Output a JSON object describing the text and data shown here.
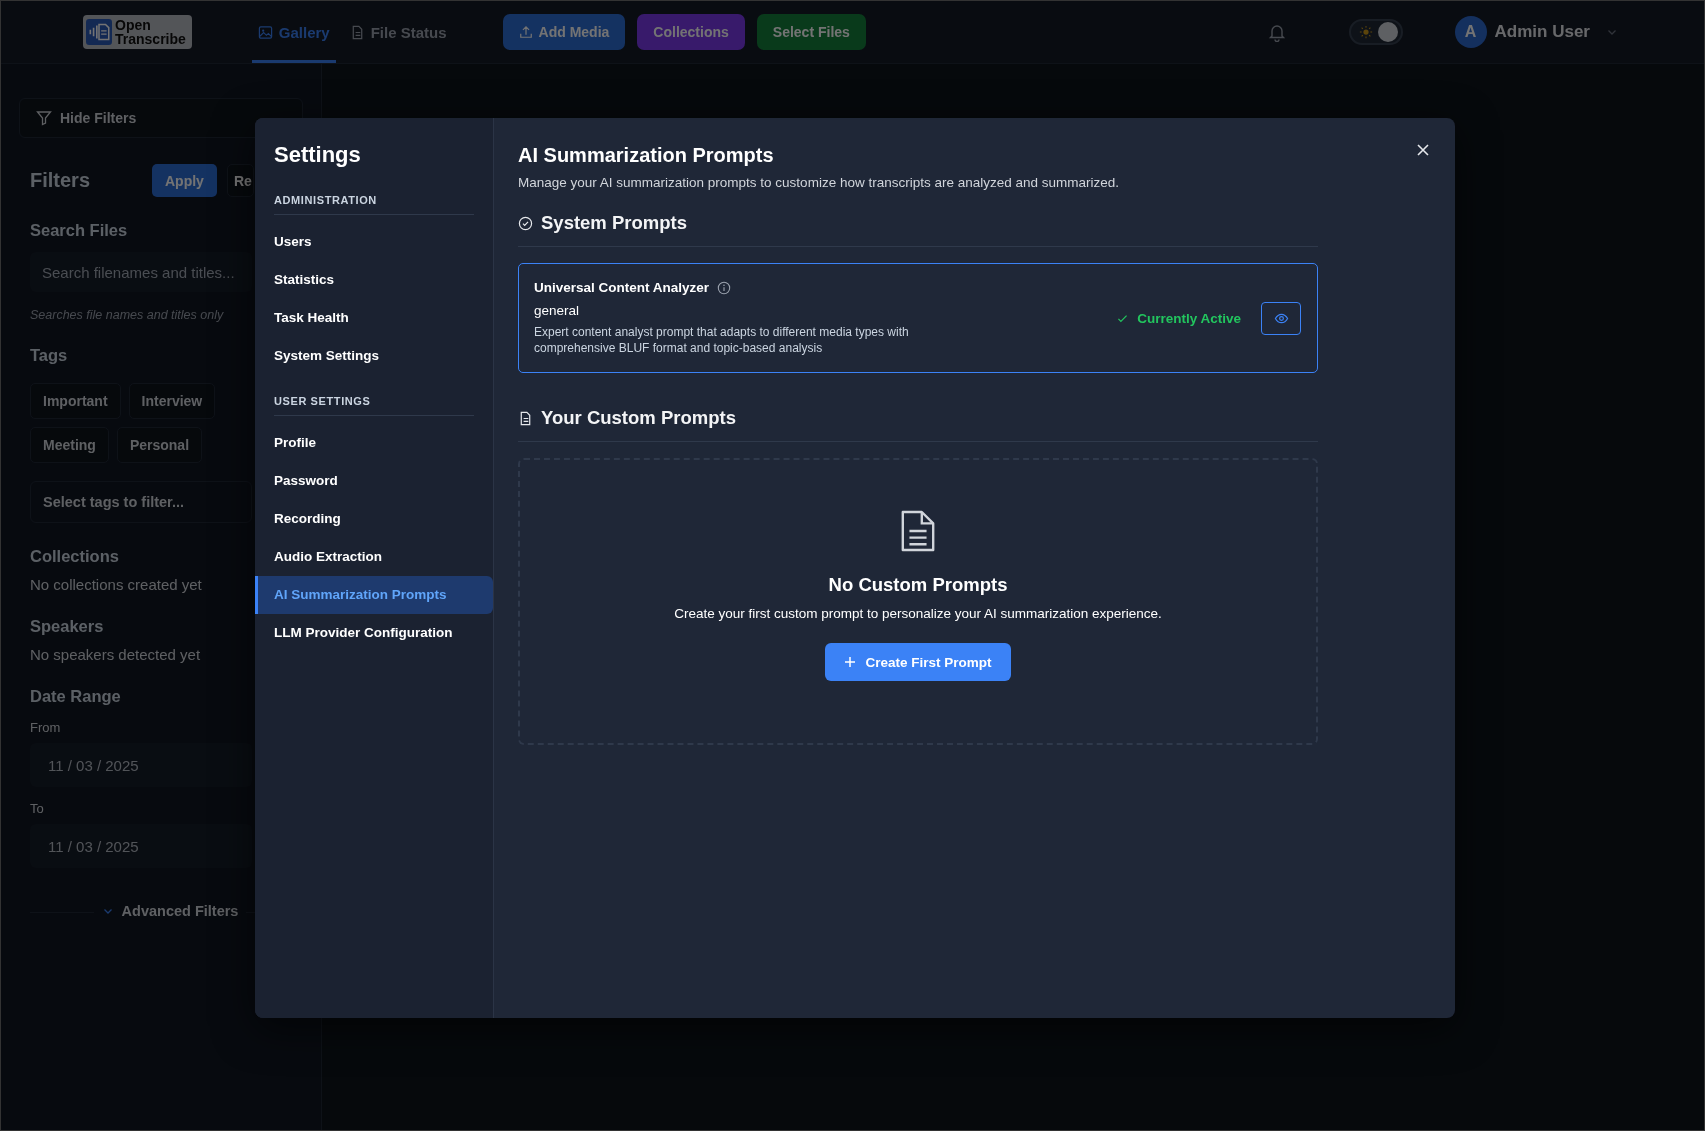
{
  "header": {
    "logo_lines": [
      "Open",
      "Transcribe"
    ],
    "nav": [
      {
        "label": "Gallery",
        "kind": "gallery",
        "selected": true
      },
      {
        "label": "File Status",
        "kind": "status",
        "selected": false
      }
    ],
    "actions": [
      {
        "label": "Add Media",
        "kind": "add"
      },
      {
        "label": "Collections",
        "kind": "collections"
      },
      {
        "label": "Select Files",
        "kind": "select"
      }
    ],
    "theme_toggle": {
      "on": true
    },
    "user": {
      "initial": "A",
      "name": "Admin User"
    }
  },
  "filters": {
    "toggle": "Hide Filters",
    "title": "Filters",
    "apply": "Apply",
    "reset": "Re",
    "search": {
      "heading": "Search Files",
      "placeholder": "Search filenames and titles...",
      "hint": "Searches file names and titles only"
    },
    "tags": {
      "heading": "Tags",
      "items": [
        "Important",
        "Interview",
        "Meeting",
        "Personal"
      ],
      "placeholder": "Select tags to filter..."
    },
    "collections": {
      "heading": "Collections",
      "empty": "No collections created yet"
    },
    "speakers": {
      "heading": "Speakers",
      "empty": "No speakers detected yet"
    },
    "date_range": {
      "heading": "Date Range",
      "from_label": "From",
      "from": "11 / 03 / 2025",
      "to_label": "To",
      "to": "11 / 03 / 2025"
    },
    "advanced": "Advanced Filters"
  },
  "settings": {
    "title": "Settings",
    "sections": [
      {
        "label": "ADMINISTRATION",
        "items": [
          {
            "label": "Users",
            "selected": false
          },
          {
            "label": "Statistics",
            "selected": false
          },
          {
            "label": "Task Health",
            "selected": false
          },
          {
            "label": "System Settings",
            "selected": false
          }
        ]
      },
      {
        "label": "USER SETTINGS",
        "items": [
          {
            "label": "Profile",
            "selected": false
          },
          {
            "label": "Password",
            "selected": false
          },
          {
            "label": "Recording",
            "selected": false
          },
          {
            "label": "Audio Extraction",
            "selected": false
          },
          {
            "label": "AI Summarization Prompts",
            "selected": true
          },
          {
            "label": "LLM Provider Configuration",
            "selected": false
          }
        ]
      }
    ],
    "content": {
      "title": "AI Summarization Prompts",
      "description": "Manage your AI summarization prompts to customize how transcripts are analyzed and summarized.",
      "system_heading": "System Prompts",
      "system_prompts": [
        {
          "name": "Universal Content Analyzer",
          "category": "general",
          "description": "Expert content analyst prompt that adapts to different media types with comprehensive BLUF format and topic-based analysis",
          "status": "Currently Active",
          "active": true
        }
      ],
      "custom_heading": "Your Custom Prompts",
      "empty": {
        "title": "No Custom Prompts",
        "text": "Create your first custom prompt to personalize your AI summarization experience.",
        "button": "Create First Prompt"
      }
    }
  }
}
